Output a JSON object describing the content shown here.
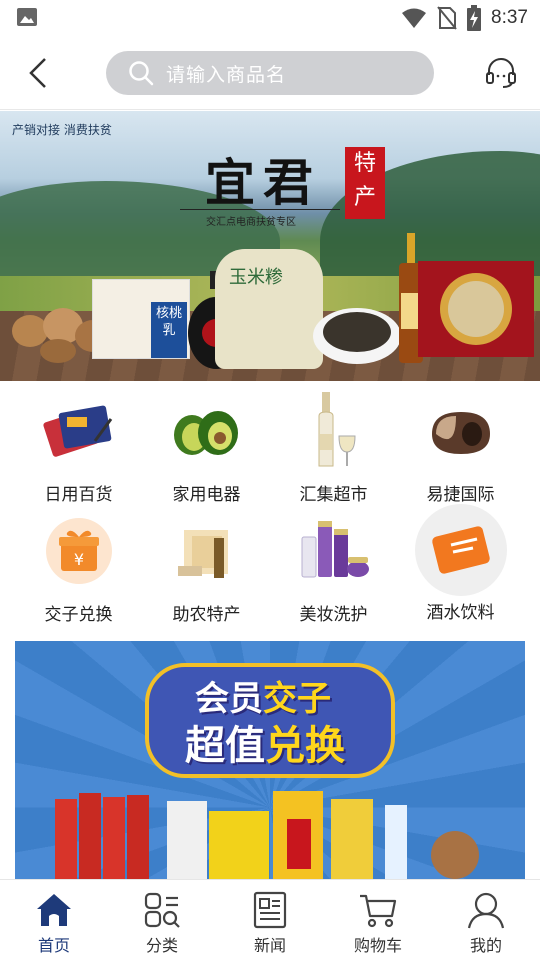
{
  "status_bar": {
    "time": "8:37",
    "icons": [
      "image-icon",
      "wifi-icon",
      "no-sim-icon",
      "battery-charging-icon"
    ]
  },
  "header": {
    "back_icon": "chevron-left-icon",
    "search_placeholder": "请输入商品名",
    "search_icon": "search-icon",
    "service_icon": "headset-icon"
  },
  "hero_banner": {
    "tagline": "产销对接  消费扶贫",
    "title": "宜君",
    "stamp_text": "特产",
    "subtitle": "交汇点电商扶贫专区",
    "product_labels": [
      "核桃乳",
      "玉米糁"
    ],
    "slide_count": 1,
    "active_slide": 1
  },
  "categories": [
    {
      "label": "日用百货",
      "icon": "daily-goods-icon"
    },
    {
      "label": "家用电器",
      "icon": "avocado-icon"
    },
    {
      "label": "汇集超市",
      "icon": "wine-bottle-icon"
    },
    {
      "label": "易捷国际",
      "icon": "massage-pillow-icon"
    },
    {
      "label": "交子兑换",
      "icon": "gift-box-icon"
    },
    {
      "label": "助农特产",
      "icon": "local-product-icon"
    },
    {
      "label": "美妆洗护",
      "icon": "cosmetics-icon"
    },
    {
      "label": "酒水饮料",
      "icon": "card-icon"
    }
  ],
  "promo_banner": {
    "line1_a": "会员",
    "line1_b": "交子",
    "line2_a": "超值",
    "line2_b": "兑换"
  },
  "tabbar": [
    {
      "label": "首页",
      "icon": "home-icon",
      "active": true
    },
    {
      "label": "分类",
      "icon": "category-icon",
      "active": false
    },
    {
      "label": "新闻",
      "icon": "news-icon",
      "active": false
    },
    {
      "label": "购物车",
      "icon": "cart-icon",
      "active": false
    },
    {
      "label": "我的",
      "icon": "user-icon",
      "active": false
    }
  ],
  "colors": {
    "accent": "#1e3a7a",
    "search_bg": "#cfd0d3",
    "stamp_red": "#c8161d",
    "promo_yellow": "#ffd61c"
  }
}
